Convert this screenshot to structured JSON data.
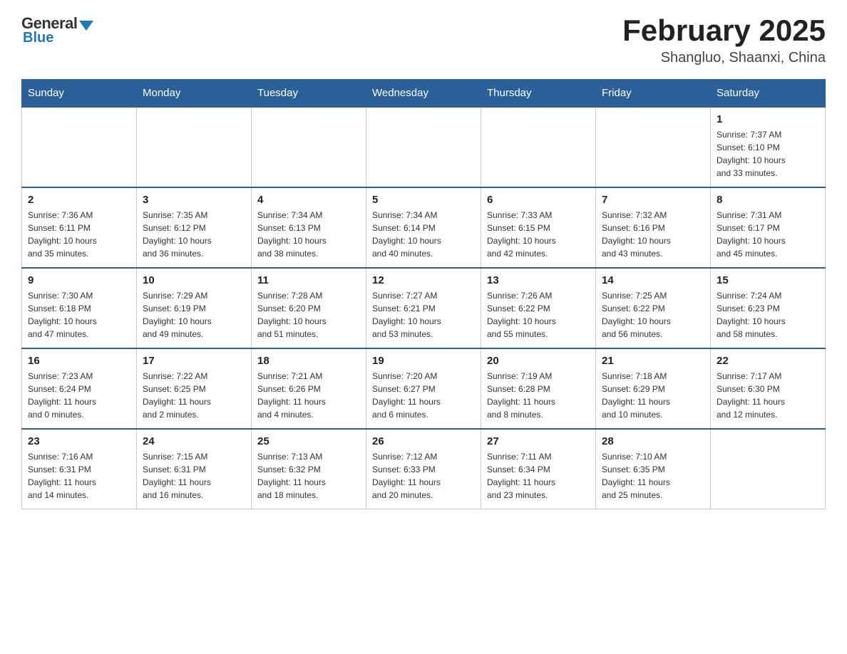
{
  "header": {
    "logo": {
      "general": "General",
      "blue": "Blue"
    },
    "title": "February 2025",
    "location": "Shangluo, Shaanxi, China"
  },
  "weekdays": [
    "Sunday",
    "Monday",
    "Tuesday",
    "Wednesday",
    "Thursday",
    "Friday",
    "Saturday"
  ],
  "weeks": [
    [
      {
        "day": "",
        "info": ""
      },
      {
        "day": "",
        "info": ""
      },
      {
        "day": "",
        "info": ""
      },
      {
        "day": "",
        "info": ""
      },
      {
        "day": "",
        "info": ""
      },
      {
        "day": "",
        "info": ""
      },
      {
        "day": "1",
        "info": "Sunrise: 7:37 AM\nSunset: 6:10 PM\nDaylight: 10 hours\nand 33 minutes."
      }
    ],
    [
      {
        "day": "2",
        "info": "Sunrise: 7:36 AM\nSunset: 6:11 PM\nDaylight: 10 hours\nand 35 minutes."
      },
      {
        "day": "3",
        "info": "Sunrise: 7:35 AM\nSunset: 6:12 PM\nDaylight: 10 hours\nand 36 minutes."
      },
      {
        "day": "4",
        "info": "Sunrise: 7:34 AM\nSunset: 6:13 PM\nDaylight: 10 hours\nand 38 minutes."
      },
      {
        "day": "5",
        "info": "Sunrise: 7:34 AM\nSunset: 6:14 PM\nDaylight: 10 hours\nand 40 minutes."
      },
      {
        "day": "6",
        "info": "Sunrise: 7:33 AM\nSunset: 6:15 PM\nDaylight: 10 hours\nand 42 minutes."
      },
      {
        "day": "7",
        "info": "Sunrise: 7:32 AM\nSunset: 6:16 PM\nDaylight: 10 hours\nand 43 minutes."
      },
      {
        "day": "8",
        "info": "Sunrise: 7:31 AM\nSunset: 6:17 PM\nDaylight: 10 hours\nand 45 minutes."
      }
    ],
    [
      {
        "day": "9",
        "info": "Sunrise: 7:30 AM\nSunset: 6:18 PM\nDaylight: 10 hours\nand 47 minutes."
      },
      {
        "day": "10",
        "info": "Sunrise: 7:29 AM\nSunset: 6:19 PM\nDaylight: 10 hours\nand 49 minutes."
      },
      {
        "day": "11",
        "info": "Sunrise: 7:28 AM\nSunset: 6:20 PM\nDaylight: 10 hours\nand 51 minutes."
      },
      {
        "day": "12",
        "info": "Sunrise: 7:27 AM\nSunset: 6:21 PM\nDaylight: 10 hours\nand 53 minutes."
      },
      {
        "day": "13",
        "info": "Sunrise: 7:26 AM\nSunset: 6:22 PM\nDaylight: 10 hours\nand 55 minutes."
      },
      {
        "day": "14",
        "info": "Sunrise: 7:25 AM\nSunset: 6:22 PM\nDaylight: 10 hours\nand 56 minutes."
      },
      {
        "day": "15",
        "info": "Sunrise: 7:24 AM\nSunset: 6:23 PM\nDaylight: 10 hours\nand 58 minutes."
      }
    ],
    [
      {
        "day": "16",
        "info": "Sunrise: 7:23 AM\nSunset: 6:24 PM\nDaylight: 11 hours\nand 0 minutes."
      },
      {
        "day": "17",
        "info": "Sunrise: 7:22 AM\nSunset: 6:25 PM\nDaylight: 11 hours\nand 2 minutes."
      },
      {
        "day": "18",
        "info": "Sunrise: 7:21 AM\nSunset: 6:26 PM\nDaylight: 11 hours\nand 4 minutes."
      },
      {
        "day": "19",
        "info": "Sunrise: 7:20 AM\nSunset: 6:27 PM\nDaylight: 11 hours\nand 6 minutes."
      },
      {
        "day": "20",
        "info": "Sunrise: 7:19 AM\nSunset: 6:28 PM\nDaylight: 11 hours\nand 8 minutes."
      },
      {
        "day": "21",
        "info": "Sunrise: 7:18 AM\nSunset: 6:29 PM\nDaylight: 11 hours\nand 10 minutes."
      },
      {
        "day": "22",
        "info": "Sunrise: 7:17 AM\nSunset: 6:30 PM\nDaylight: 11 hours\nand 12 minutes."
      }
    ],
    [
      {
        "day": "23",
        "info": "Sunrise: 7:16 AM\nSunset: 6:31 PM\nDaylight: 11 hours\nand 14 minutes."
      },
      {
        "day": "24",
        "info": "Sunrise: 7:15 AM\nSunset: 6:31 PM\nDaylight: 11 hours\nand 16 minutes."
      },
      {
        "day": "25",
        "info": "Sunrise: 7:13 AM\nSunset: 6:32 PM\nDaylight: 11 hours\nand 18 minutes."
      },
      {
        "day": "26",
        "info": "Sunrise: 7:12 AM\nSunset: 6:33 PM\nDaylight: 11 hours\nand 20 minutes."
      },
      {
        "day": "27",
        "info": "Sunrise: 7:11 AM\nSunset: 6:34 PM\nDaylight: 11 hours\nand 23 minutes."
      },
      {
        "day": "28",
        "info": "Sunrise: 7:10 AM\nSunset: 6:35 PM\nDaylight: 11 hours\nand 25 minutes."
      },
      {
        "day": "",
        "info": ""
      }
    ]
  ]
}
